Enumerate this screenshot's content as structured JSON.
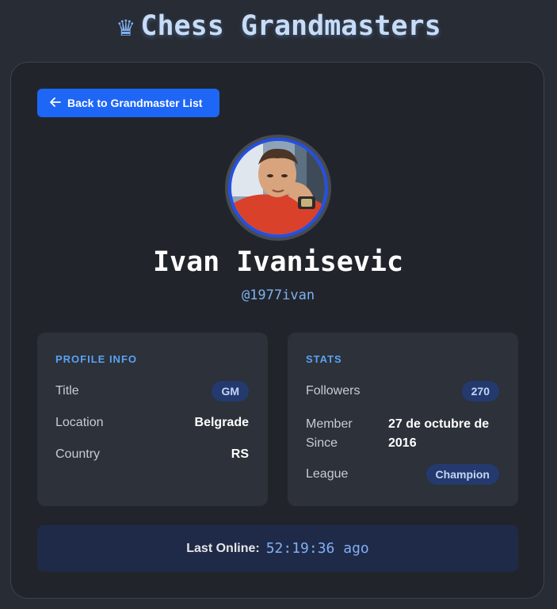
{
  "header": {
    "icon": "crown-icon",
    "glyph": "♛",
    "title": "Chess Grandmasters"
  },
  "back_button": {
    "icon": "arrow-left-icon",
    "label": "Back to Grandmaster List"
  },
  "profile": {
    "avatar_alt": "Ivan Ivanisevic avatar",
    "name": "Ivan Ivanisevic",
    "handle": "@1977ivan"
  },
  "profile_info": {
    "title": "PROFILE INFO",
    "rows": [
      {
        "label": "Title",
        "value": "GM"
      },
      {
        "label": "Location",
        "value": "Belgrade"
      },
      {
        "label": "Country",
        "value": "RS"
      }
    ]
  },
  "stats": {
    "title": "STATS",
    "rows": [
      {
        "label": "Followers",
        "value": "270"
      },
      {
        "label": "Member Since",
        "value": "27 de octubre de 2016"
      },
      {
        "label": "League",
        "value": "Champion"
      }
    ]
  },
  "last_online": {
    "label": "Last Online:",
    "value": "52:19:36 ago"
  },
  "colors": {
    "background": "#282c34",
    "card": "#21252b",
    "accent_blue": "#1e66f5",
    "link_blue": "#7fb0f2",
    "badge_bg": "#243a6e"
  }
}
